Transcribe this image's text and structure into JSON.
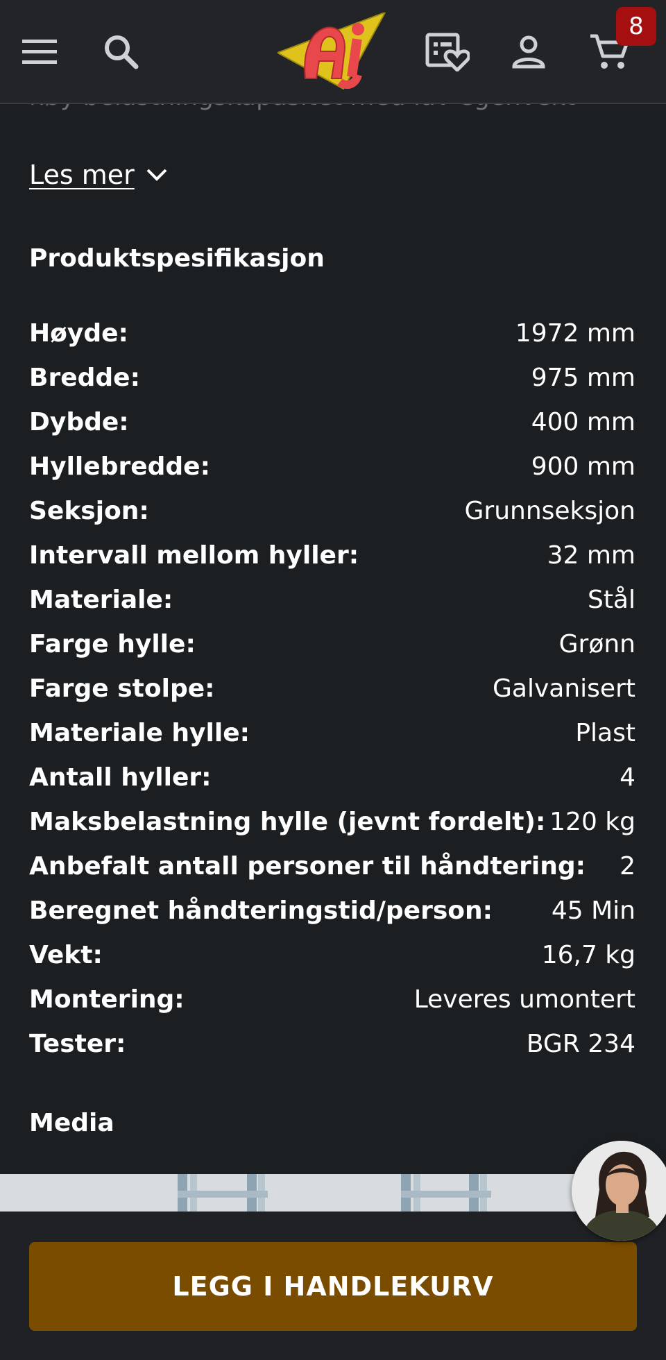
{
  "header": {
    "menu_icon": "hamburger-menu-icon",
    "search_icon": "search-icon",
    "logo_icon": "aj-logo",
    "wishlist_icon": "wishlist-heart-icon",
    "account_icon": "account-icon",
    "cart_icon": "shopping-cart-icon",
    "cart_count": "8"
  },
  "description": {
    "faded_text": "høy belastningskapasitet med lav egenvekt",
    "read_more_label": "Les mer"
  },
  "spec_section": {
    "title": "Produktspesifikasjon",
    "rows": [
      {
        "label": "Høyde:",
        "value": "1972 mm"
      },
      {
        "label": "Bredde:",
        "value": "975 mm"
      },
      {
        "label": "Dybde:",
        "value": "400 mm"
      },
      {
        "label": "Hyllebredde:",
        "value": "900 mm"
      },
      {
        "label": "Seksjon:",
        "value": "Grunnseksjon"
      },
      {
        "label": "Intervall mellom hyller:",
        "value": "32 mm"
      },
      {
        "label": "Materiale:",
        "value": "Stål"
      },
      {
        "label": "Farge hylle:",
        "value": "Grønn"
      },
      {
        "label": "Farge stolpe:",
        "value": "Galvanisert"
      },
      {
        "label": "Materiale hylle:",
        "value": "Plast"
      },
      {
        "label": "Antall hyller:",
        "value": "4"
      },
      {
        "label": "Maksbelastning hylle (jevnt fordelt):",
        "value": "120 kg"
      },
      {
        "label": "Anbefalt antall personer til håndtering:",
        "value": "2"
      },
      {
        "label": "Beregnet håndteringstid/person:",
        "value": "45 Min"
      },
      {
        "label": "Vekt:",
        "value": "16,7 kg"
      },
      {
        "label": "Montering:",
        "value": "Leveres umontert"
      },
      {
        "label": "Tester:",
        "value": "BGR 234"
      }
    ]
  },
  "media_section": {
    "title": "Media"
  },
  "cta": {
    "add_to_cart_label": "LEGG I HANDLEKURV"
  },
  "colors": {
    "background": "#1c1f22",
    "header": "#222427",
    "cta": "#7a4c00",
    "badge": "#a50f0f"
  }
}
